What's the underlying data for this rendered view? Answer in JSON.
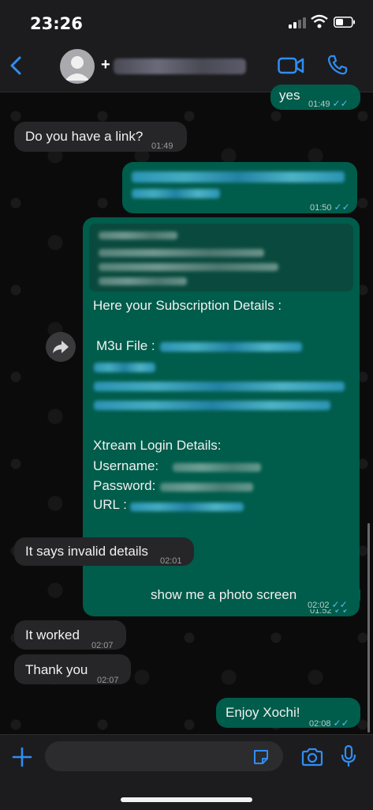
{
  "status_bar": {
    "time": "23:26"
  },
  "header": {
    "contact_prefix": "+"
  },
  "messages": {
    "m1": {
      "text": "yes",
      "time": "01:49"
    },
    "m2": {
      "text": "Do you have a link?",
      "time": "01:49"
    },
    "m3": {
      "time": "01:50"
    },
    "m4": {
      "line1": "Here your Subscription Details :",
      "m3u_label": "M3u File :",
      "xtream_title": "Xtream Login Details:",
      "username_label": "Username:",
      "password_label": "Password:",
      "url_label": "URL :",
      "time": "01:52"
    },
    "m5": {
      "text": "It says invalid details",
      "time": "02:01"
    },
    "m6": {
      "text": "show me a photo screen",
      "time": "02:02"
    },
    "m7": {
      "text": "It worked",
      "time": "02:07"
    },
    "m8": {
      "text": "Thank you",
      "time": "02:07"
    },
    "m9": {
      "text": "Enjoy Xochi!",
      "time": "02:08"
    }
  },
  "colors": {
    "outgoing": "#005c4b",
    "incoming": "#262628",
    "accent": "#2f8ef4",
    "read_ticks": "#53bdeb"
  },
  "icons": [
    "back-chevron-icon",
    "avatar-icon",
    "video-call-icon",
    "phone-icon",
    "forward-icon",
    "plus-icon",
    "sticker-icon",
    "camera-icon",
    "mic-icon"
  ]
}
